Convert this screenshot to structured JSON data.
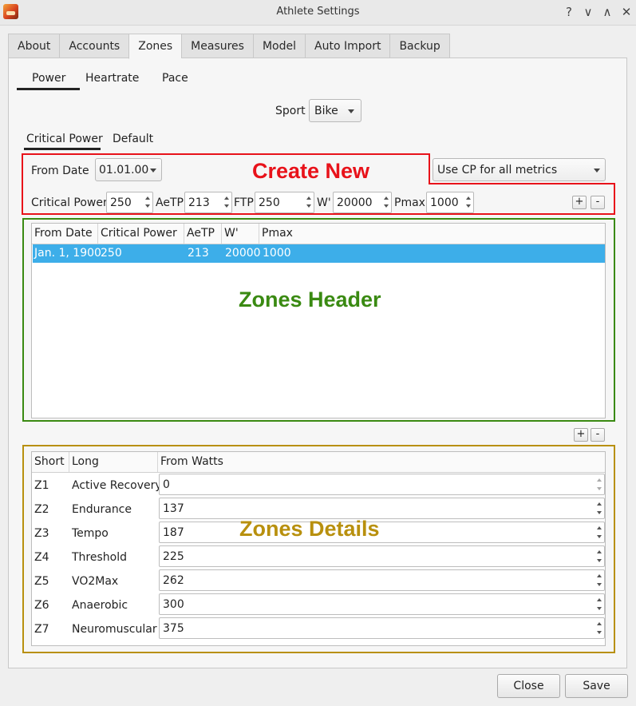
{
  "window": {
    "title": "Athlete Settings",
    "help_glyph": "?",
    "minimize_glyph": "∨",
    "maximize_glyph": "∧",
    "close_glyph": "✕"
  },
  "tabs": [
    "About",
    "Accounts",
    "Zones",
    "Measures",
    "Model",
    "Auto Import",
    "Backup"
  ],
  "subtabs": [
    "Power",
    "Heartrate",
    "Pace"
  ],
  "sport": {
    "label": "Sport",
    "value": "Bike"
  },
  "modeltabs": [
    "Critical Power",
    "Default"
  ],
  "create": {
    "from_date_label": "From Date",
    "from_date_value": "01.01.00",
    "cp_mode": "Use CP for all metrics",
    "cp_label": "Critical Power",
    "cp_value": "250",
    "aetp_label": "AeTP",
    "aetp_value": "213",
    "ftp_label": "FTP",
    "ftp_value": "250",
    "w_label": "W'",
    "w_value": "20000",
    "pmax_label": "Pmax",
    "pmax_value": "1000",
    "add": "+",
    "remove": "-"
  },
  "ranges_table": {
    "headers": [
      "From Date",
      "Critical Power",
      "AeTP",
      "W'",
      "Pmax"
    ],
    "rows": [
      [
        "Jan. 1, 1900",
        "250",
        "213",
        "20000",
        "1000"
      ]
    ]
  },
  "zones_controls": {
    "add": "+",
    "remove": "-"
  },
  "zones_table": {
    "headers": [
      "Short",
      "Long",
      "From Watts"
    ],
    "rows": [
      {
        "short": "Z1",
        "long": "Active Recovery",
        "watts": "0"
      },
      {
        "short": "Z2",
        "long": "Endurance",
        "watts": "137"
      },
      {
        "short": "Z3",
        "long": "Tempo",
        "watts": "187"
      },
      {
        "short": "Z4",
        "long": "Threshold",
        "watts": "225"
      },
      {
        "short": "Z5",
        "long": "VO2Max",
        "watts": "262"
      },
      {
        "short": "Z6",
        "long": "Anaerobic",
        "watts": "300"
      },
      {
        "short": "Z7",
        "long": "Neuromuscular",
        "watts": "375"
      }
    ]
  },
  "annotations": {
    "create_new": "Create New",
    "zones_header": "Zones Header",
    "zones_details": "Zones Details",
    "colors": {
      "red": "#e8121a",
      "green": "#3a8a12",
      "gold": "#b8900e"
    }
  },
  "buttons": {
    "close": "Close",
    "save": "Save"
  },
  "colors": {
    "selection": "#3daee9"
  }
}
